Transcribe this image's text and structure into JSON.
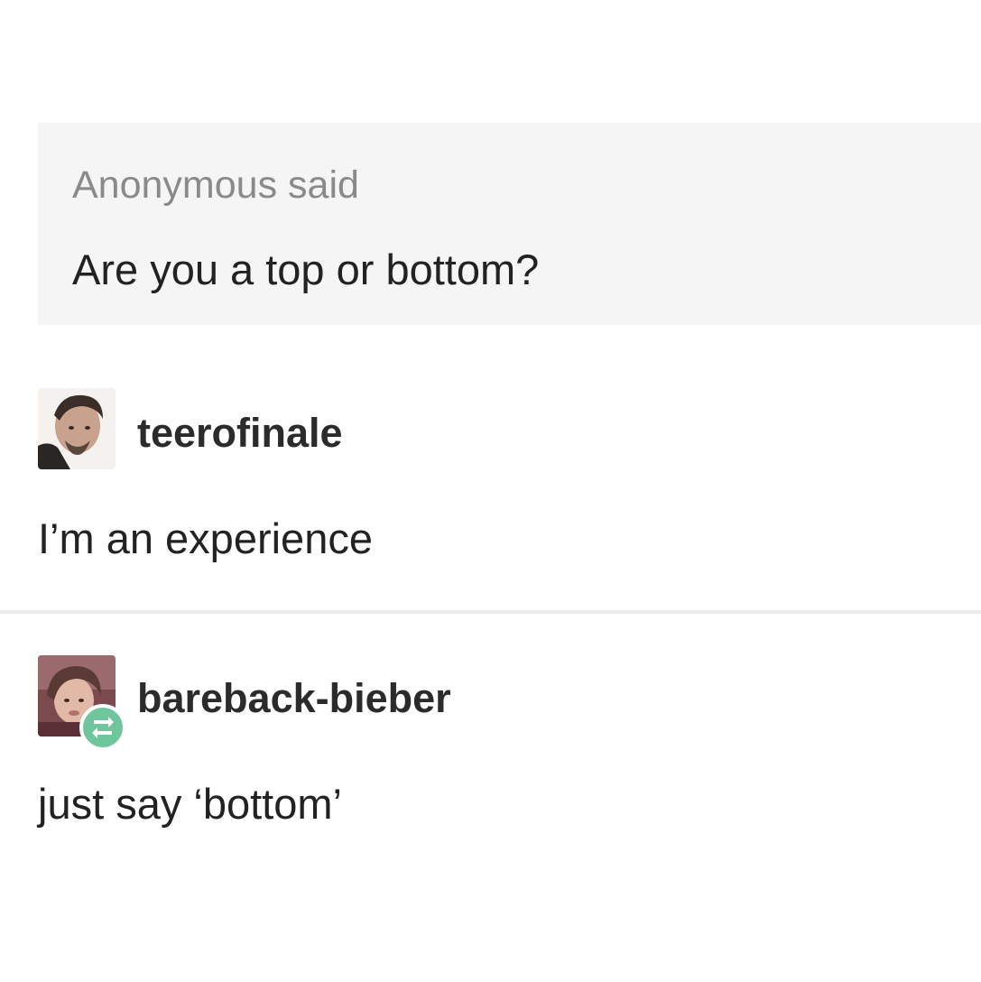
{
  "ask": {
    "asker": "Anonymous",
    "said_label": "said",
    "question": "Are you a top or bottom?"
  },
  "replies": [
    {
      "username": "teerofinale",
      "text": "I’m an experience",
      "avatar_icon": "person-avatar-icon"
    },
    {
      "username": "bareback-bieber",
      "text": "just say ‘bottom’",
      "avatar_icon": "person-avatar-icon",
      "badge_icon": "reblog-icon",
      "badge_color": "#6fc59c"
    }
  ]
}
